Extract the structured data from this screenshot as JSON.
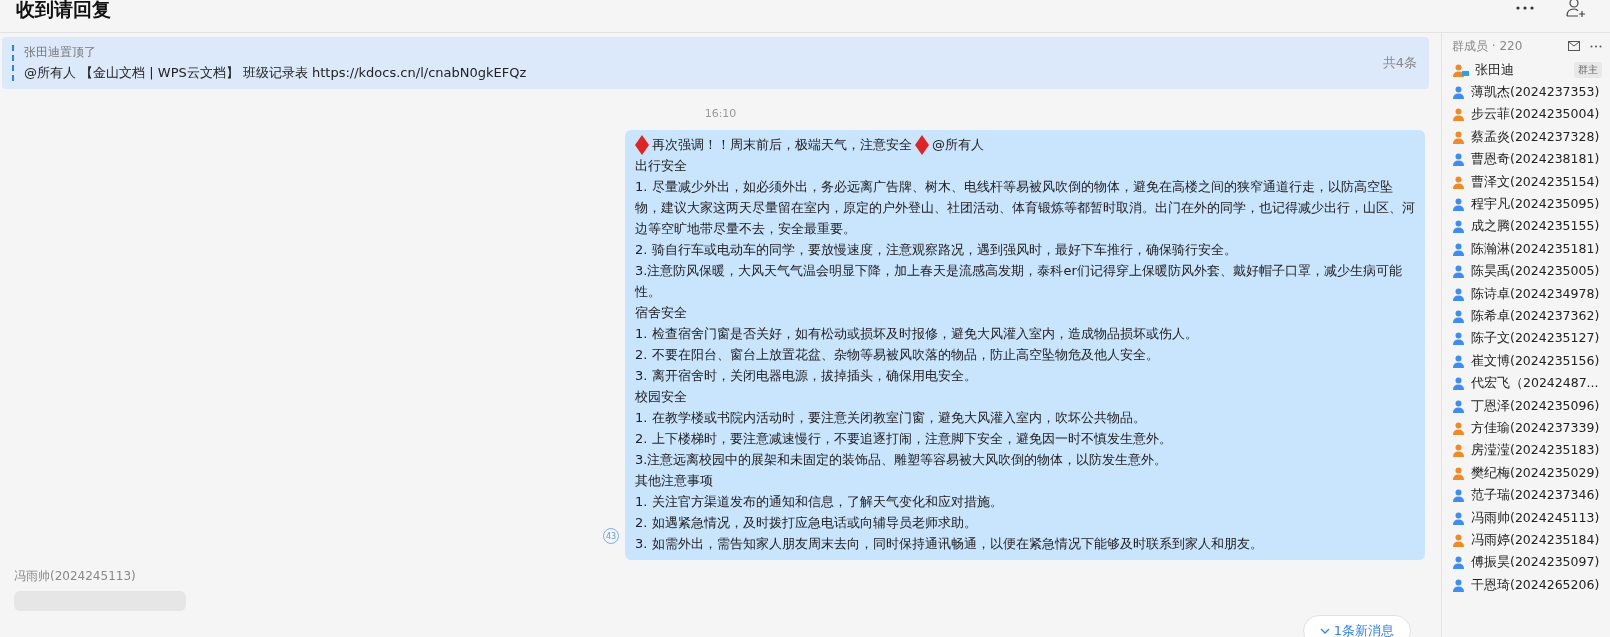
{
  "header": {
    "title": "收到请回复"
  },
  "pinned": {
    "by": "张田迪置顶了",
    "text": "@所有人 【金山文档 | WPS云文档】 班级记录表 https://kdocs.cn/l/cnabN0gkEFQz",
    "count": "共4条"
  },
  "timestamp": "16:10",
  "message": {
    "title": "再次强调！！周末前后，极端天气，注意安全",
    "mention": "@所有人",
    "read_count": "43",
    "lines": [
      "出行安全",
      "1. 尽量减少外出，如必须外出，务必远离广告牌、树木、电线杆等易被风吹倒的物体，避免在高楼之间的狭窄通道行走，以防高空坠物，建议大家这两天尽量留在室内，原定的户外登山、社团活动、体育锻炼等都暂时取消。出门在外的同学，也记得减少出行，山区、河边等空旷地带尽量不去，安全最重要。",
      "2. 骑自行车或电动车的同学，要放慢速度，注意观察路况，遇到强风时，最好下车推行，确保骑行安全。",
      "3.注意防风保暖，大风天气气温会明显下降，加上春天是流感高发期，泰科er们记得穿上保暖防风外套、戴好帽子口罩，减少生病可能性。",
      "宿舍安全",
      "1. 检查宿舍门窗是否关好，如有松动或损坏及时报修，避免大风灌入室内，造成物品损坏或伤人。",
      "2. 不要在阳台、窗台上放置花盆、杂物等易被风吹落的物品，防止高空坠物危及他人安全。",
      "3. 离开宿舍时，关闭电器电源，拔掉插头，确保用电安全。",
      "校园安全",
      "1. 在教学楼或书院内活动时，要注意关闭教室门窗，避免大风灌入室内，吹坏公共物品。",
      "2. 上下楼梯时，要注意减速慢行，不要追逐打闹，注意脚下安全，避免因一时不慎发生意外。",
      "3.注意远离校园中的展架和未固定的装饰品、雕塑等容易被大风吹倒的物体，以防发生意外。",
      "其他注意事项",
      "1. 关注官方渠道发布的通知和信息，了解天气变化和应对措施。",
      "2. 如遇紧急情况，及时拨打应急电话或向辅导员老师求助。",
      "3. 如需外出，需告知家人朋友周末去向，同时保持通讯畅通，以便在紧急情况下能够及时联系到家人和朋友。"
    ]
  },
  "next_sender": "冯雨帅(2024245113)",
  "new_messages": "1条新消息",
  "members": {
    "title": "群成员 · 220",
    "list": [
      {
        "name": "张田迪",
        "color": "#f08a24",
        "badge": "群主"
      },
      {
        "name": "薄凯杰(2024237353)",
        "color": "#3d8ef0"
      },
      {
        "name": "步云菲(2024235004)",
        "color": "#f08a24"
      },
      {
        "name": "蔡孟炎(2024237328)",
        "color": "#f08a24"
      },
      {
        "name": "曹恩奇(2024238181)",
        "color": "#3d8ef0"
      },
      {
        "name": "曹泽文(2024235154)",
        "color": "#f08a24"
      },
      {
        "name": "程宇凡(2024235095)",
        "color": "#3d8ef0"
      },
      {
        "name": "成之腾(2024235155)",
        "color": "#3d8ef0"
      },
      {
        "name": "陈瀚淋(2024235181)",
        "color": "#3d8ef0"
      },
      {
        "name": "陈昊禹(2024235005)",
        "color": "#3d8ef0"
      },
      {
        "name": "陈诗卓(2024234978)",
        "color": "#3d8ef0"
      },
      {
        "name": "陈希卓(2024237362)",
        "color": "#3d8ef0"
      },
      {
        "name": "陈子文(2024235127)",
        "color": "#3d8ef0"
      },
      {
        "name": "崔文博(2024235156)",
        "color": "#3d8ef0"
      },
      {
        "name": "代宏飞（20242487...",
        "color": "#3d8ef0"
      },
      {
        "name": "丁恩泽(2024235096)",
        "color": "#3d8ef0"
      },
      {
        "name": "方佳瑜(2024237339)",
        "color": "#f08a24"
      },
      {
        "name": "房滢滢(2024235183)",
        "color": "#f08a24"
      },
      {
        "name": "樊纪梅(2024235029)",
        "color": "#f08a24"
      },
      {
        "name": "范子瑞(2024237346)",
        "color": "#3d8ef0"
      },
      {
        "name": "冯雨帅(2024245113)",
        "color": "#3d8ef0"
      },
      {
        "name": "冯雨婷(2024235184)",
        "color": "#f08a24"
      },
      {
        "name": "傅振昊(2024235097)",
        "color": "#3d8ef0"
      },
      {
        "name": "干恩琦(2024265206)",
        "color": "#3d8ef0"
      }
    ]
  }
}
